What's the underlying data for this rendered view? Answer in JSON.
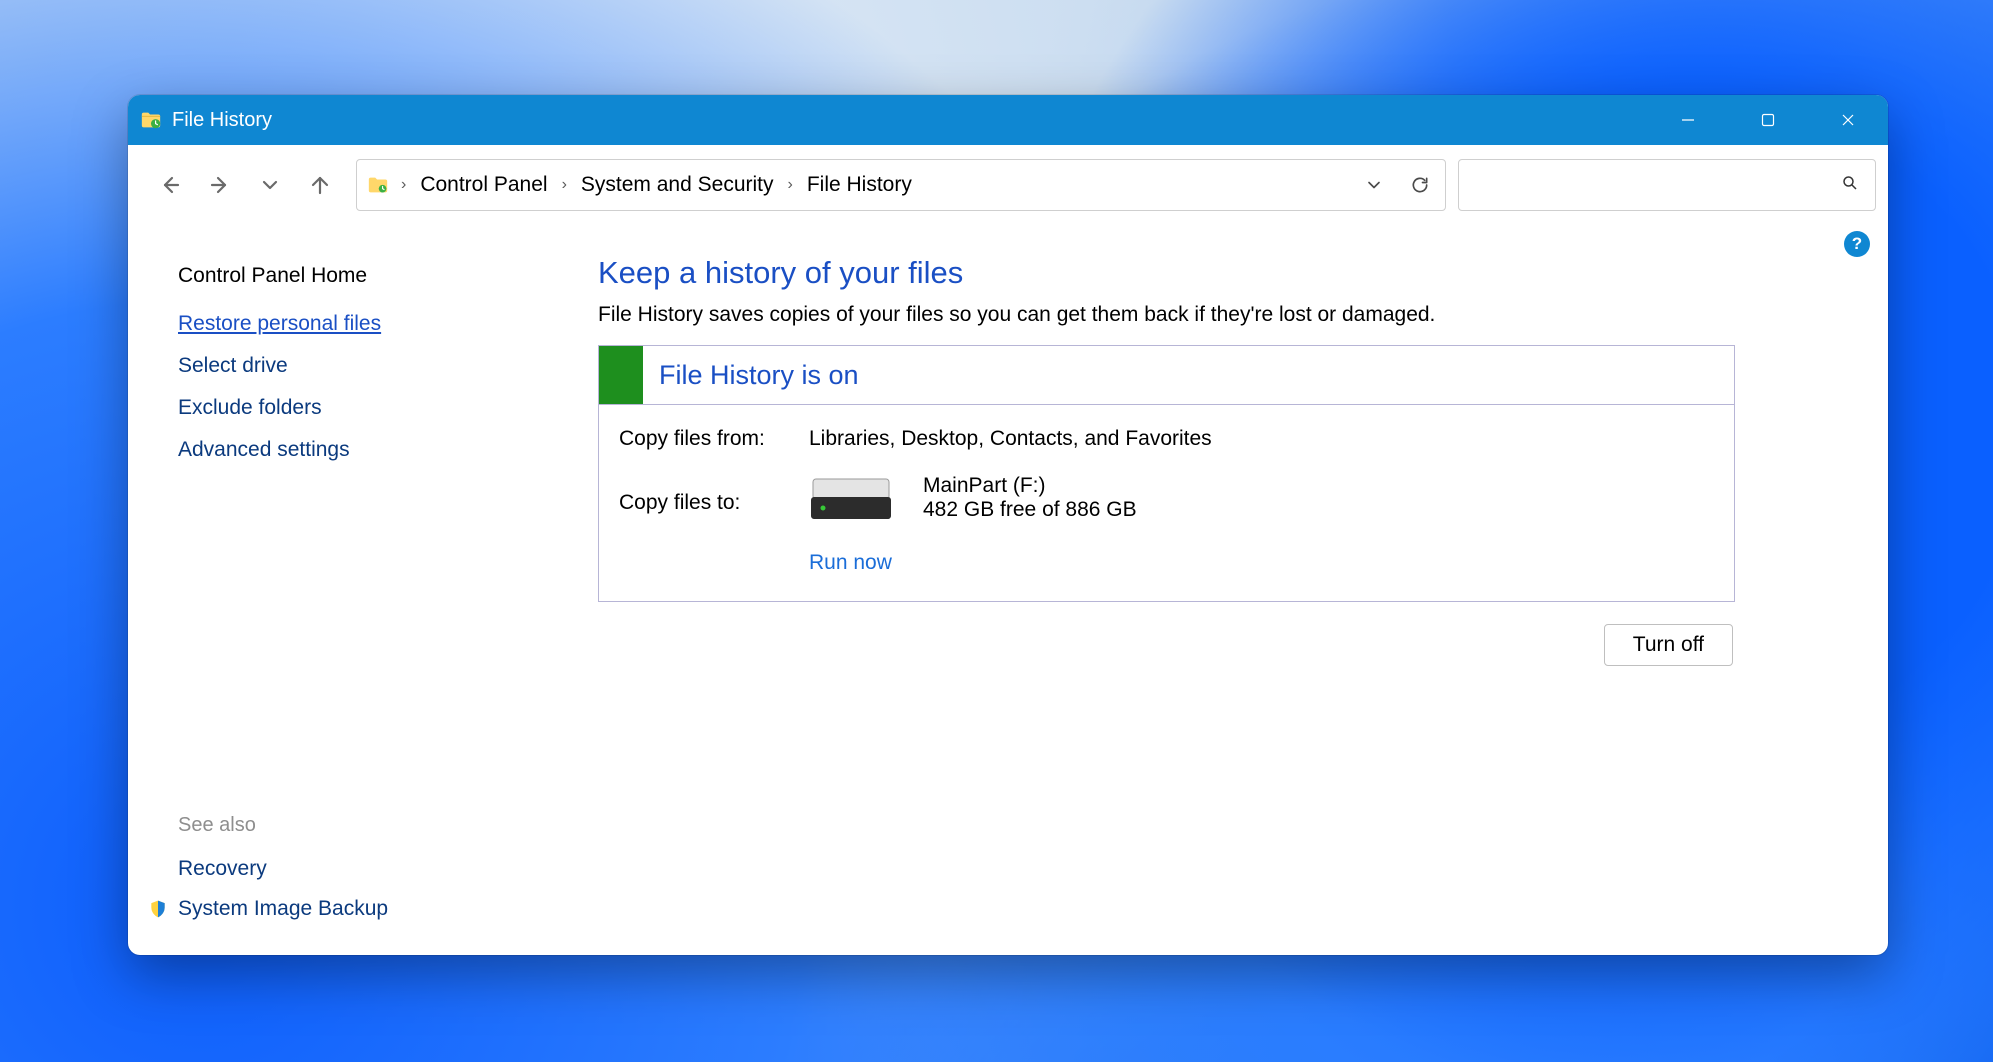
{
  "titlebar": {
    "title": "File History"
  },
  "breadcrumb": {
    "items": [
      "Control Panel",
      "System and Security",
      "File History"
    ]
  },
  "sidebar": {
    "home": "Control Panel Home",
    "links": [
      {
        "label": "Restore personal files",
        "active": true
      },
      {
        "label": "Select drive",
        "active": false
      },
      {
        "label": "Exclude folders",
        "active": false
      },
      {
        "label": "Advanced settings",
        "active": false
      }
    ],
    "see_also_label": "See also",
    "see_also": [
      {
        "label": "Recovery",
        "shield": false
      },
      {
        "label": "System Image Backup",
        "shield": true
      }
    ]
  },
  "main": {
    "heading": "Keep a history of your files",
    "subtitle": "File History saves copies of your files so you can get them back if they're lost or damaged.",
    "status_title": "File History is on",
    "copy_from_label": "Copy files from:",
    "copy_from_value": "Libraries, Desktop, Contacts, and Favorites",
    "copy_to_label": "Copy files to:",
    "drive_name": "MainPart (F:)",
    "drive_free": "482 GB free of 886 GB",
    "run_now": "Run now",
    "turn_off": "Turn off"
  },
  "help": {
    "symbol": "?"
  }
}
